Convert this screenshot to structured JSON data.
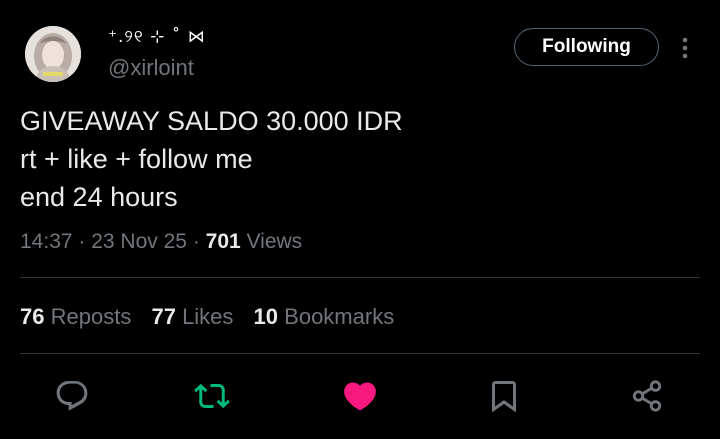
{
  "author": {
    "display_name": "⁺.୨୧ ⊹ ˚ ⋈",
    "handle": "@xirloint"
  },
  "follow_button": {
    "label": "Following"
  },
  "tweet": {
    "lines": [
      "GIVEAWAY SALDO 30.000 IDR",
      "rt + like + follow me",
      "end 24 hours"
    ]
  },
  "meta": {
    "time": "14:37",
    "date": "23 Nov 25",
    "views_count": "701",
    "views_label": "Views"
  },
  "stats": {
    "reposts_count": "76",
    "reposts_label": "Reposts",
    "likes_count": "77",
    "likes_label": "Likes",
    "bookmarks_count": "10",
    "bookmarks_label": "Bookmarks"
  },
  "actions": {
    "reply_icon": "reply-icon",
    "retweet_icon": "retweet-icon",
    "like_icon": "heart-icon",
    "bookmark_icon": "bookmark-icon",
    "share_icon": "share-icon"
  },
  "colors": {
    "background": "#000000",
    "text": "#e7e9ea",
    "secondary": "#71767b",
    "retweet_active": "#00ba7c",
    "like_active": "#f91880",
    "border": "#2f3336"
  }
}
